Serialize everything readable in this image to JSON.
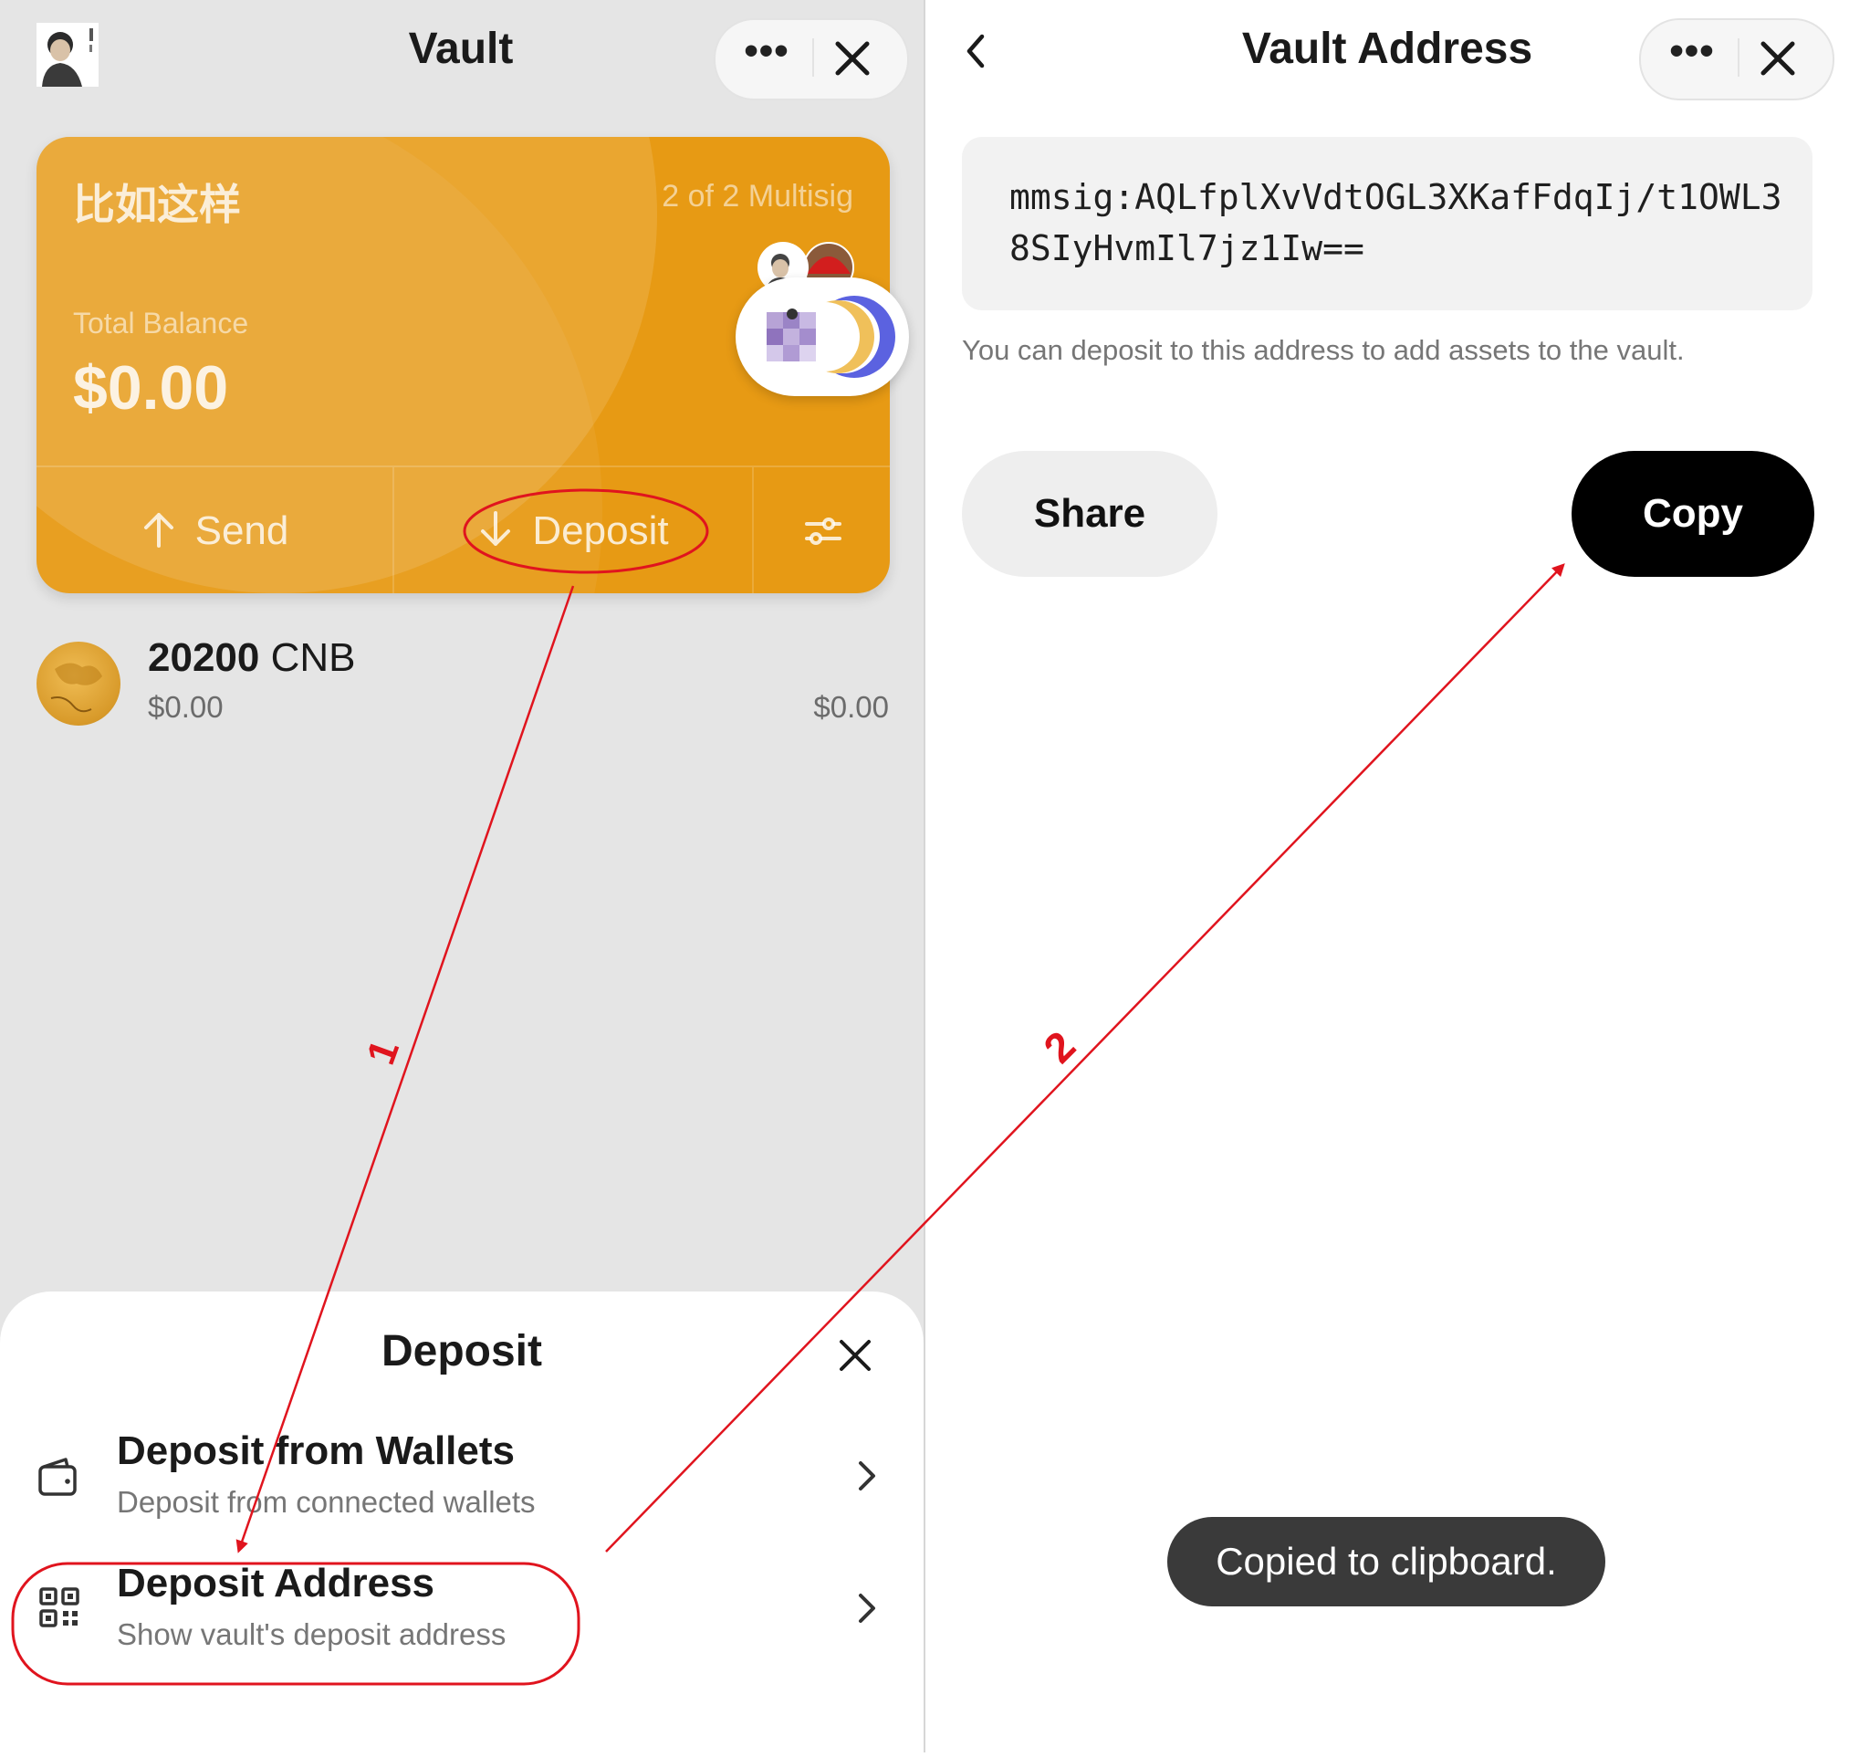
{
  "left": {
    "header": {
      "title": "Vault"
    },
    "vault_card": {
      "name": "比如这样",
      "multisig": "2 of 2 Multisig",
      "balance_label": "Total Balance",
      "balance": "$0.00",
      "send_label": "Send",
      "deposit_label": "Deposit"
    },
    "asset": {
      "amount": "20200",
      "symbol": "CNB",
      "value": "$0.00",
      "total": "$0.00"
    },
    "sheet": {
      "title": "Deposit",
      "items": [
        {
          "title": "Deposit from Wallets",
          "subtitle": "Deposit from connected wallets",
          "icon": "wallet-icon"
        },
        {
          "title": "Deposit Address",
          "subtitle": "Show vault's deposit address",
          "icon": "qr-code-icon"
        }
      ]
    }
  },
  "right": {
    "header": {
      "title": "Vault Address"
    },
    "address": "mmsig:AQLfplXvVdtOGL3XKafFdqIj/t1OWL38SIyHvmIl7jz1Iw==",
    "hint": "You can deposit to this address to add assets to the vault.",
    "share_label": "Share",
    "copy_label": "Copy",
    "toast": "Copied to clipboard."
  },
  "annotations": {
    "step1": "1",
    "step2": "2"
  },
  "colors": {
    "card": "#e79a14",
    "annotation": "#e0141e",
    "toast": "#3a3a3a"
  }
}
